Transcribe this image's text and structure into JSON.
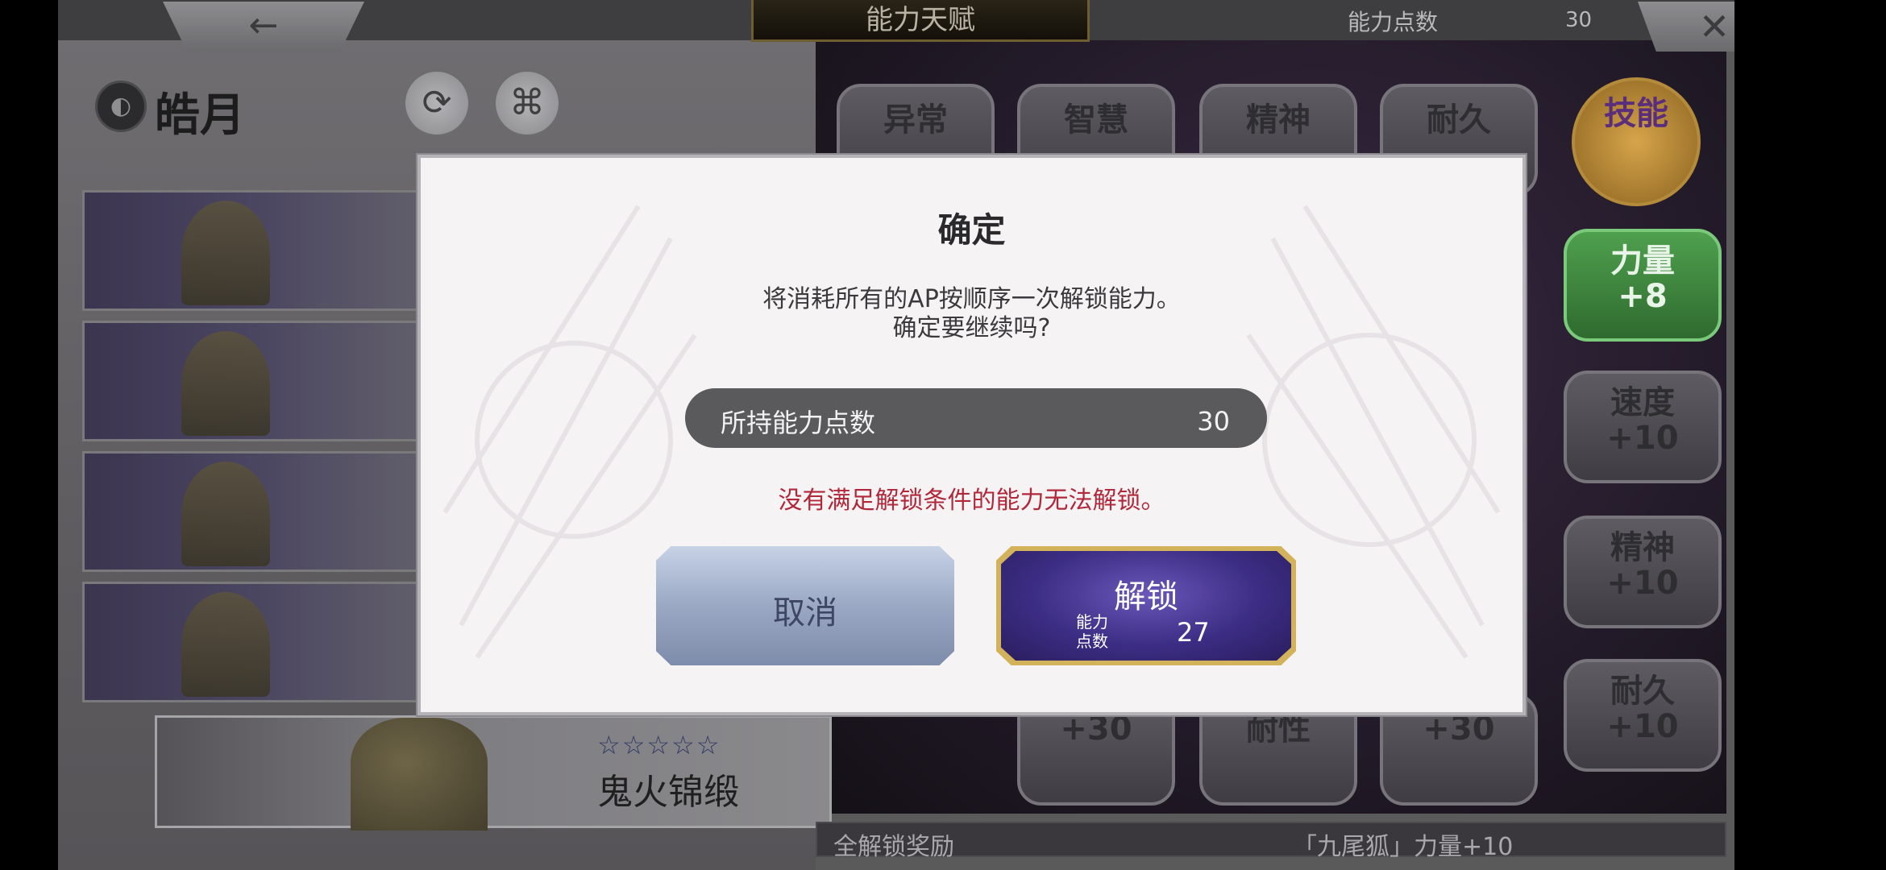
{
  "header": {
    "back_icon": "←",
    "title": "能力天赋",
    "ap_label": "能力点数",
    "ap_value": "30",
    "close_icon": "✕"
  },
  "character": {
    "name": "皓月",
    "refresh_icon": "⟳",
    "link_icon": "⌘"
  },
  "selected_card": {
    "stars": "☆☆☆☆☆",
    "name": "鬼火锦缎"
  },
  "ability_grid": [
    "异常",
    "智慧",
    "精神",
    "耐久",
    "技能",
    "力量\n+8",
    "速度\n+10",
    "精神\n+10",
    "耐久\n+10",
    "+30",
    "耐性",
    "+30"
  ],
  "bottom_bar": {
    "label": "全解锁奖励",
    "reward": "「九尾狐」力量+10"
  },
  "modal": {
    "title": "确定",
    "message_line1": "将消耗所有的AP按顺序一次解锁能力。",
    "message_line2": "确定要继续吗?",
    "ap_bar_label": "所持能力点数",
    "ap_bar_value": "30",
    "warning": "没有满足解锁条件的能力无法解锁。",
    "cancel_label": "取消",
    "unlock_label": "解锁",
    "cost_label": "能力\n点数",
    "cost_value": "27"
  },
  "colors": {
    "warning": "#b0283a",
    "unlock_button": "#3c2d84",
    "unlock_border": "#d2b25a",
    "cancel_button": "#9aa8c4",
    "modal_bg": "#f6f3f4"
  }
}
